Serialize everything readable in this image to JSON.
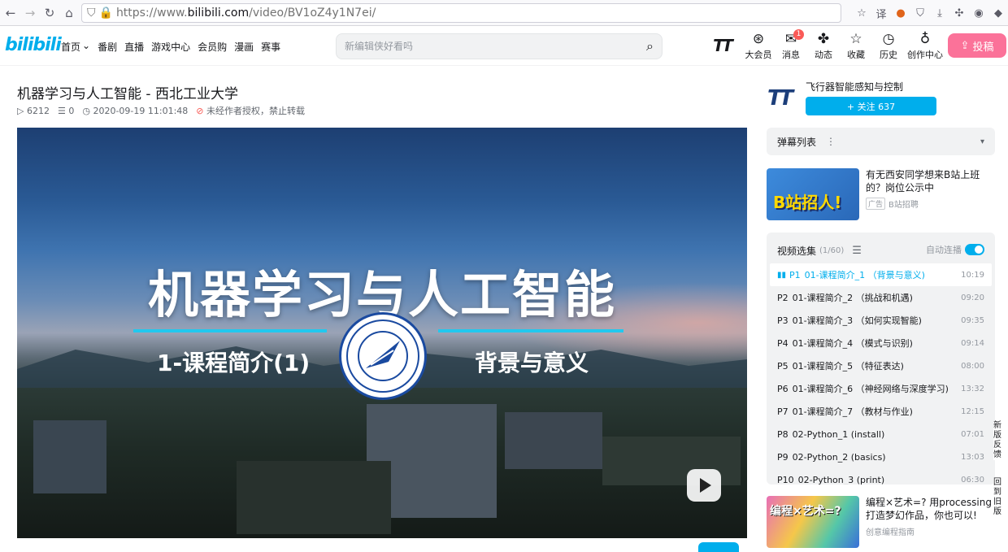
{
  "browser": {
    "url_prefix": "https://www.",
    "url_host": "bilibili.com",
    "url_path": "/video/BV1oZ4y1N7ei/"
  },
  "header": {
    "logo": "bilibili",
    "nav": [
      "首页",
      "番剧",
      "直播",
      "游戏中心",
      "会员购",
      "漫画",
      "赛事"
    ],
    "search_placeholder": "新编辑侠好看吗",
    "user_logo": "TT",
    "items": [
      {
        "label": "大会员",
        "icon": "vip-icon"
      },
      {
        "label": "消息",
        "icon": "message-icon",
        "badge": "1"
      },
      {
        "label": "动态",
        "icon": "dynamic-icon"
      },
      {
        "label": "收藏",
        "icon": "star-icon"
      },
      {
        "label": "历史",
        "icon": "clock-icon"
      },
      {
        "label": "创作中心",
        "icon": "bulb-icon"
      }
    ],
    "upload_label": "投稿"
  },
  "video": {
    "title": "机器学习与人工智能 - 西北工业大学",
    "views": "6212",
    "danmaku": "0",
    "date": "2020-09-19 11:01:48",
    "rights": "未经作者授权，禁止转载",
    "cover_title": "机器学习与人工智能",
    "cover_left": "1-课程简介(1)",
    "cover_right": "背景与意义"
  },
  "uploader": {
    "avatar_text": "TT",
    "name": "飞行器智能感知与控制",
    "follow_label": "+ 关注 637"
  },
  "danmaku_list": {
    "label": "弹幕列表"
  },
  "ad": {
    "thumb_text": "B站招人!",
    "title": "有无西安同学想来B站上班的？岗位公示中",
    "tag": "广告",
    "source": "B站招聘"
  },
  "episodes": {
    "title": "视频选集",
    "count": "(1/60)",
    "autoplay_label": "自动连播",
    "items": [
      {
        "p": "P1",
        "name": "01-课程简介_1 （背景与意义)",
        "dur": "10:19",
        "active": true
      },
      {
        "p": "P2",
        "name": "01-课程简介_2 （挑战和机遇)",
        "dur": "09:20"
      },
      {
        "p": "P3",
        "name": "01-课程简介_3 （如何实现智能)",
        "dur": "09:35"
      },
      {
        "p": "P4",
        "name": "01-课程简介_4 （模式与识别)",
        "dur": "09:14"
      },
      {
        "p": "P5",
        "name": "01-课程简介_5 （特征表达)",
        "dur": "08:00"
      },
      {
        "p": "P6",
        "name": "01-课程简介_6 （神经网络与深度学习)",
        "dur": "13:32"
      },
      {
        "p": "P7",
        "name": "01-课程简介_7 （教材与作业)",
        "dur": "12:15"
      },
      {
        "p": "P8",
        "name": "02-Python_1 (install)",
        "dur": "07:01"
      },
      {
        "p": "P9",
        "name": "02-Python_2 (basics)",
        "dur": "13:03"
      },
      {
        "p": "P10",
        "name": "02-Python_3 (print)",
        "dur": "06:30"
      }
    ]
  },
  "recommend": {
    "thumb_text": "编程×艺术=?",
    "title": "编程×艺术=? 用processing打造梦幻作品，你也可以!",
    "source": "创意编程指南"
  },
  "side_tools": [
    "新版反馈",
    "回到旧版"
  ],
  "colors": {
    "accent": "#00aeec",
    "pink": "#fb7299",
    "badge": "#fa5a57"
  }
}
